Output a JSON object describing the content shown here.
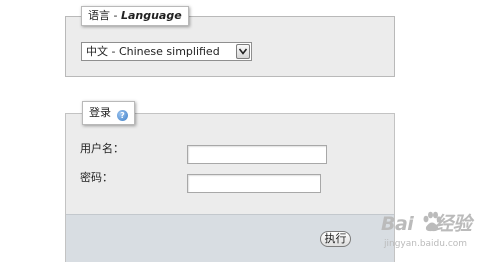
{
  "language_section": {
    "legend_prefix": "语言",
    "legend_separator": " - ",
    "legend_english": "Language",
    "selected_language": "中文 - Chinese simplified"
  },
  "login_section": {
    "legend": "登录",
    "help_icon_glyph": "?",
    "username_label": "用户名：",
    "password_label": "密码：",
    "username_value": "",
    "password_value": "",
    "submit_label": "执行"
  },
  "watermark": {
    "brand_left": "Bai",
    "brand_right": "经验",
    "url": "jingyan.baidu.com"
  }
}
